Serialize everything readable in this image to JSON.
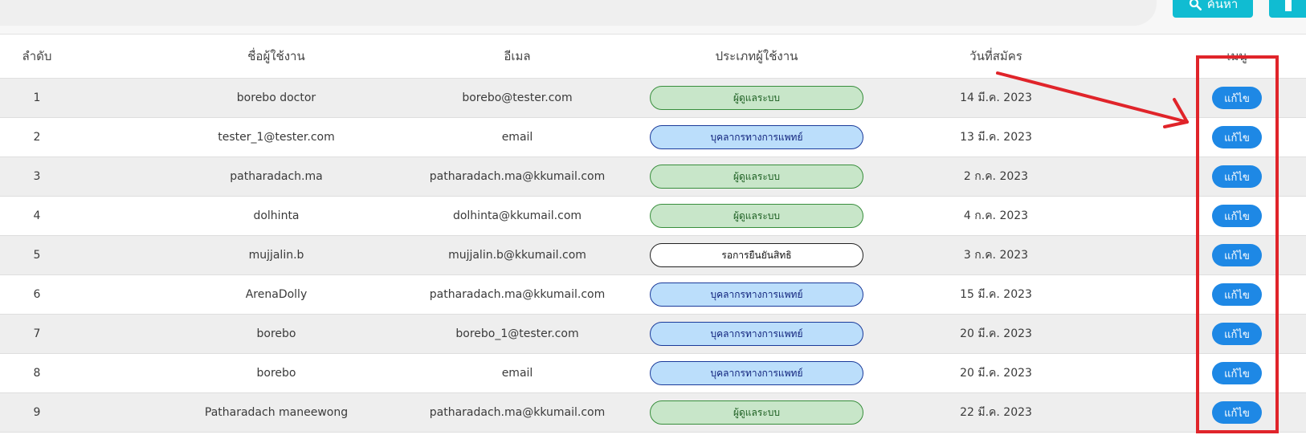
{
  "toolbar": {
    "search_label": "ค้นหา",
    "search_icon": "search-icon",
    "accent_color": "#10bcd2"
  },
  "table": {
    "headers": {
      "index": "ลำดับ",
      "username": "ชื่อผู้ใช้งาน",
      "email": "อีเมล",
      "user_type": "ประเภทผู้ใช้งาน",
      "register_date": "วันที่สมัคร",
      "menu": "เมนู"
    },
    "rows": [
      {
        "index": "1",
        "username": "borebo doctor",
        "email": "borebo@tester.com",
        "user_type": "ผู้ดูแลระบบ",
        "type_style": "green",
        "register_date": "14 มี.ค. 2023",
        "action": "แก้ไข"
      },
      {
        "index": "2",
        "username": "tester_1@tester.com",
        "email": "email",
        "user_type": "บุคลากรทางการแพทย์",
        "type_style": "blue",
        "register_date": "13 มี.ค. 2023",
        "action": "แก้ไข"
      },
      {
        "index": "3",
        "username": "patharadach.ma",
        "email": "patharadach.ma@kkumail.com",
        "user_type": "ผู้ดูแลระบบ",
        "type_style": "green",
        "register_date": "2 ก.ค. 2023",
        "action": "แก้ไข"
      },
      {
        "index": "4",
        "username": "dolhinta",
        "email": "dolhinta@kkumail.com",
        "user_type": "ผู้ดูแลระบบ",
        "type_style": "green",
        "register_date": "4 ก.ค. 2023",
        "action": "แก้ไข"
      },
      {
        "index": "5",
        "username": "mujjalin.b",
        "email": "mujjalin.b@kkumail.com",
        "user_type": "รอการยืนยันสิทธิ",
        "type_style": "white",
        "register_date": "3 ก.ค. 2023",
        "action": "แก้ไข"
      },
      {
        "index": "6",
        "username": "ArenaDolly",
        "email": "patharadach.ma@kkumail.com",
        "user_type": "บุคลากรทางการแพทย์",
        "type_style": "blue",
        "register_date": "15 มี.ค. 2023",
        "action": "แก้ไข"
      },
      {
        "index": "7",
        "username": "borebo",
        "email": "borebo_1@tester.com",
        "user_type": "บุคลากรทางการแพทย์",
        "type_style": "blue",
        "register_date": "20 มี.ค. 2023",
        "action": "แก้ไข"
      },
      {
        "index": "8",
        "username": "borebo",
        "email": "email",
        "user_type": "บุคลากรทางการแพทย์",
        "type_style": "blue",
        "register_date": "20 มี.ค. 2023",
        "action": "แก้ไข"
      },
      {
        "index": "9",
        "username": "Patharadach maneewong",
        "email": "patharadach.ma@kkumail.com",
        "user_type": "ผู้ดูแลระบบ",
        "type_style": "green",
        "register_date": "22 มี.ค. 2023",
        "action": "แก้ไข"
      }
    ]
  },
  "colors": {
    "edit_button": "#1e88e5",
    "admin_badge": "#c8e6c9",
    "medical_badge": "#bbdefb",
    "pending_badge": "#ffffff",
    "annotation": "#e0242a"
  }
}
